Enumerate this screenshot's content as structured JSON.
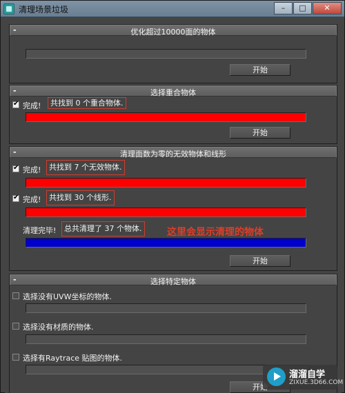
{
  "window": {
    "title": "清理场景垃圾",
    "controls": {
      "minimize": "–",
      "maximize": "□",
      "close": "✕"
    }
  },
  "rollouts": {
    "optimize": {
      "title": "优化超过10000面的物体",
      "progress": 0,
      "button": "开始"
    },
    "overlap": {
      "title": "选择重合物体",
      "status_label": "完成!",
      "status_checked": true,
      "result": "共找到 0 个重合物体.",
      "progress": 1.0,
      "bar_color": "#ff0000",
      "button": "开始"
    },
    "zero_faces": {
      "title": "清理面数为零的无效物体和线形",
      "invalid": {
        "status_label": "完成!",
        "checked": true,
        "result": "共找到 7 个无效物体.",
        "progress": 1.0,
        "bar_color": "#ff0000"
      },
      "shapes": {
        "status_label": "完成!",
        "checked": true,
        "result": "共找到 30 个线形.",
        "progress": 1.0,
        "bar_color": "#ff0000"
      },
      "cleanup": {
        "status_label": "清理完毕!",
        "result": "总共清理了 37 个物体.",
        "progress": 1.0,
        "bar_color": "#0000cc"
      },
      "annotation": "这里会显示清理的物体",
      "annotation_color": "#e03d28",
      "button": "开始"
    },
    "specific": {
      "title": "选择特定物体",
      "options": [
        {
          "label": "选择没有UVW坐标的物体.",
          "checked": false,
          "progress": 0
        },
        {
          "label": "选择没有材质的物体.",
          "checked": false,
          "progress": 0
        },
        {
          "label": "选择有Raytrace 贴图的物体.",
          "checked": false,
          "progress": 0
        }
      ],
      "button": "开始"
    }
  },
  "watermark": {
    "brand": "溜溜自学",
    "url": "ZIXUE.3D66.COM",
    "logo_icon": "play-logo-icon"
  },
  "colors": {
    "panel_bg": "#444444",
    "titlebar": "#7f93a6",
    "red_bar": "#ff0000",
    "blue_bar": "#0000cc",
    "highlight_box": "#d23d2d"
  }
}
